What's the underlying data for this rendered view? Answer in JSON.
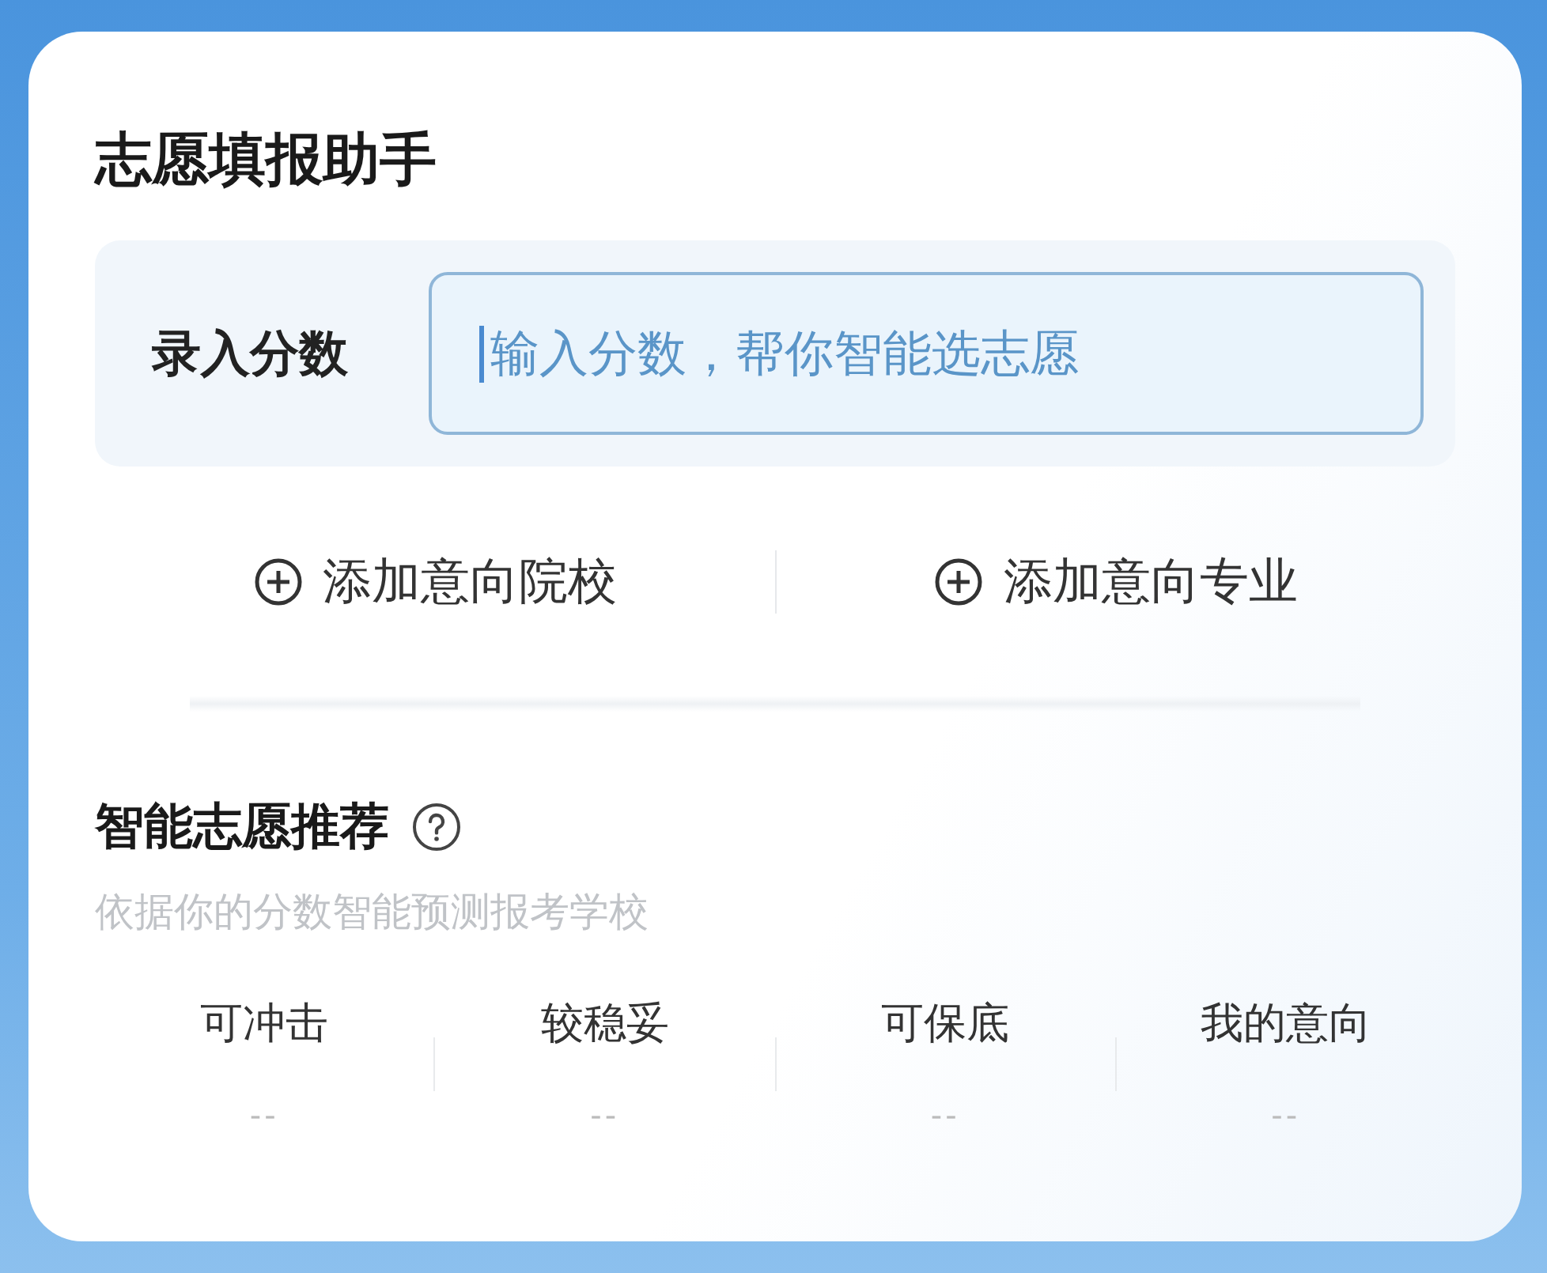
{
  "title": "志愿填报助手",
  "score": {
    "label": "录入分数",
    "placeholder": "输入分数，帮你智能选志愿"
  },
  "actions": [
    {
      "label": "添加意向院校"
    },
    {
      "label": "添加意向专业"
    }
  ],
  "recommend": {
    "title": "智能志愿推荐",
    "subtitle": "依据你的分数智能预测报考学校",
    "columns": [
      {
        "label": "可冲击",
        "value": "--"
      },
      {
        "label": "较稳妥",
        "value": "--"
      },
      {
        "label": "可保底",
        "value": "--"
      },
      {
        "label": "我的意向",
        "value": "--"
      }
    ]
  }
}
